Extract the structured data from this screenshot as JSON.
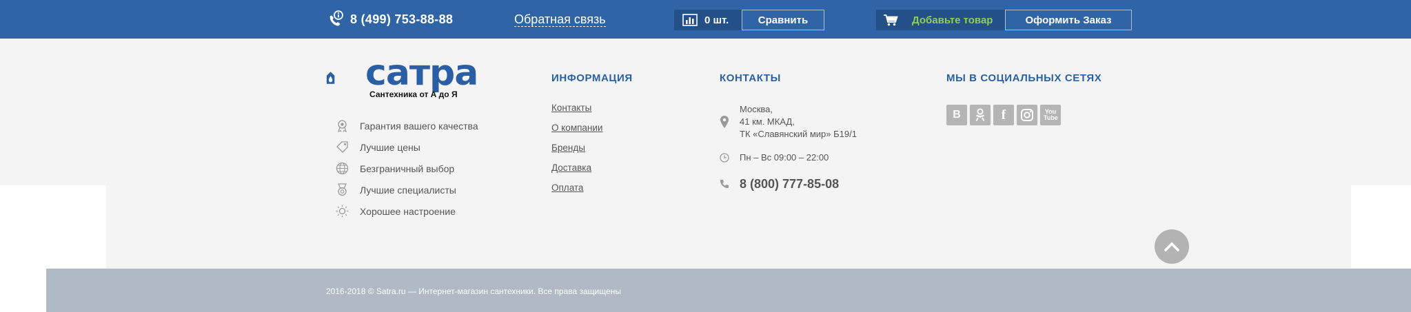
{
  "topbar": {
    "phone": "8 (499) 753-88-88",
    "feedback_label": "Обратная связь",
    "compare_count": "0 шт.",
    "compare_label": "Сравнить",
    "cart_add_label": "Добавьте товар",
    "order_label": "Оформить Заказ",
    "bg_color": "#2f64a6",
    "accent_green": "#8fd14f"
  },
  "logo": {
    "name": "сатра",
    "tagline": "Сантехника от А до Я"
  },
  "features": [
    {
      "icon": "medal-icon",
      "label": "Гарантия вашего качества"
    },
    {
      "icon": "tag-icon",
      "label": "Лучшие цены"
    },
    {
      "icon": "globe-icon",
      "label": "Безграничный выбор"
    },
    {
      "icon": "award-icon",
      "label": "Лучшие специалисты"
    },
    {
      "icon": "sun-icon",
      "label": "Хорошее настроение"
    }
  ],
  "info": {
    "title": "ИНФОРМАЦИЯ",
    "links": [
      "Контакты",
      "О компании",
      "Бренды",
      "Доставка",
      "Оплата"
    ]
  },
  "contacts": {
    "title": "КОНТАКТЫ",
    "address_line1": "Москва,",
    "address_line2": "41 км. МКАД,",
    "address_line3": "ТК «Славянский мир» Б19/1",
    "hours": "Пн – Вс 09:00 – 22:00",
    "phone": "8 (800) 777-85-08"
  },
  "social": {
    "title": "МЫ В СОЦИАЛЬНЫХ СЕТЯХ",
    "items": [
      {
        "icon": "vk-icon",
        "glyph": "В"
      },
      {
        "icon": "odnoklassniki-icon",
        "glyph": "ок"
      },
      {
        "icon": "facebook-icon",
        "glyph": "f"
      },
      {
        "icon": "instagram-icon",
        "glyph": ""
      },
      {
        "icon": "youtube-icon",
        "glyph": "You Tube"
      }
    ]
  },
  "footer": {
    "copyright": "2016-2018 © Satra.ru — Интернет-магазин сантехники. Все права защищены"
  }
}
